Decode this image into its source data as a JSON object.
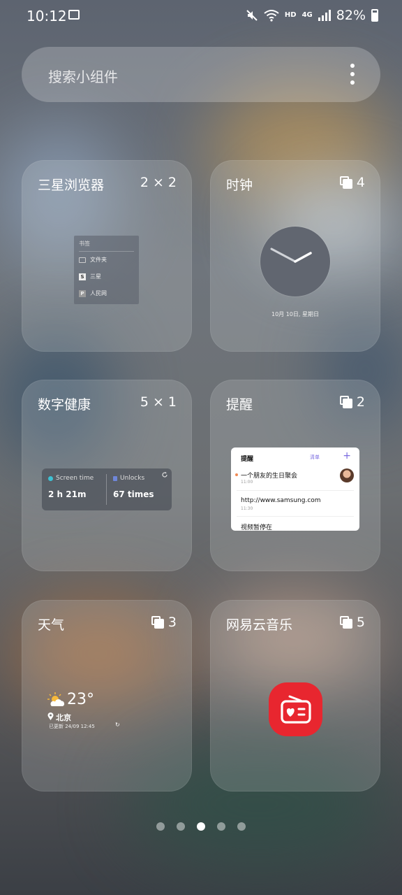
{
  "status_bar": {
    "time": "10:12",
    "hd_label": "HD",
    "network_label": "4G",
    "battery": "82%"
  },
  "search": {
    "placeholder": "搜索小组件"
  },
  "widgets": [
    {
      "name": "三星浏览器",
      "size": "2 × 2",
      "preview": {
        "header": "书签",
        "items": [
          "文件夹",
          "三星",
          "人民网"
        ],
        "item_marks": [
          "",
          "S",
          "P"
        ]
      }
    },
    {
      "name": "时钟",
      "count": "4",
      "preview": {
        "date": "10月 10日, 星期日"
      }
    },
    {
      "name": "数字健康",
      "size": "5 × 1",
      "preview": {
        "screen_time_label": "Screen time",
        "screen_time_value": "2 h 21m",
        "unlocks_label": "Unlocks",
        "unlocks_value": "67 times"
      }
    },
    {
      "name": "提醒",
      "count": "2",
      "preview": {
        "header": "提醒",
        "list_label": "清单",
        "items": [
          {
            "text": "一个朋友的生日聚会",
            "time": "11:00"
          },
          {
            "text": "http://www.samsung.com",
            "time": "11:30"
          },
          {
            "text": "视频暂停在",
            "time": ""
          }
        ]
      }
    },
    {
      "name": "天气",
      "count": "3",
      "preview": {
        "temperature": "23°",
        "city": "北京",
        "updated": "已更新 24/09 12:45"
      }
    },
    {
      "name": "网易云音乐",
      "count": "5"
    }
  ],
  "page_indicator": {
    "total": 5,
    "current": 3
  },
  "colors": {
    "music_icon": "#e8262f",
    "reminder_accent": "#7a6be0",
    "screen_time_dot": "#3ec1d3"
  }
}
